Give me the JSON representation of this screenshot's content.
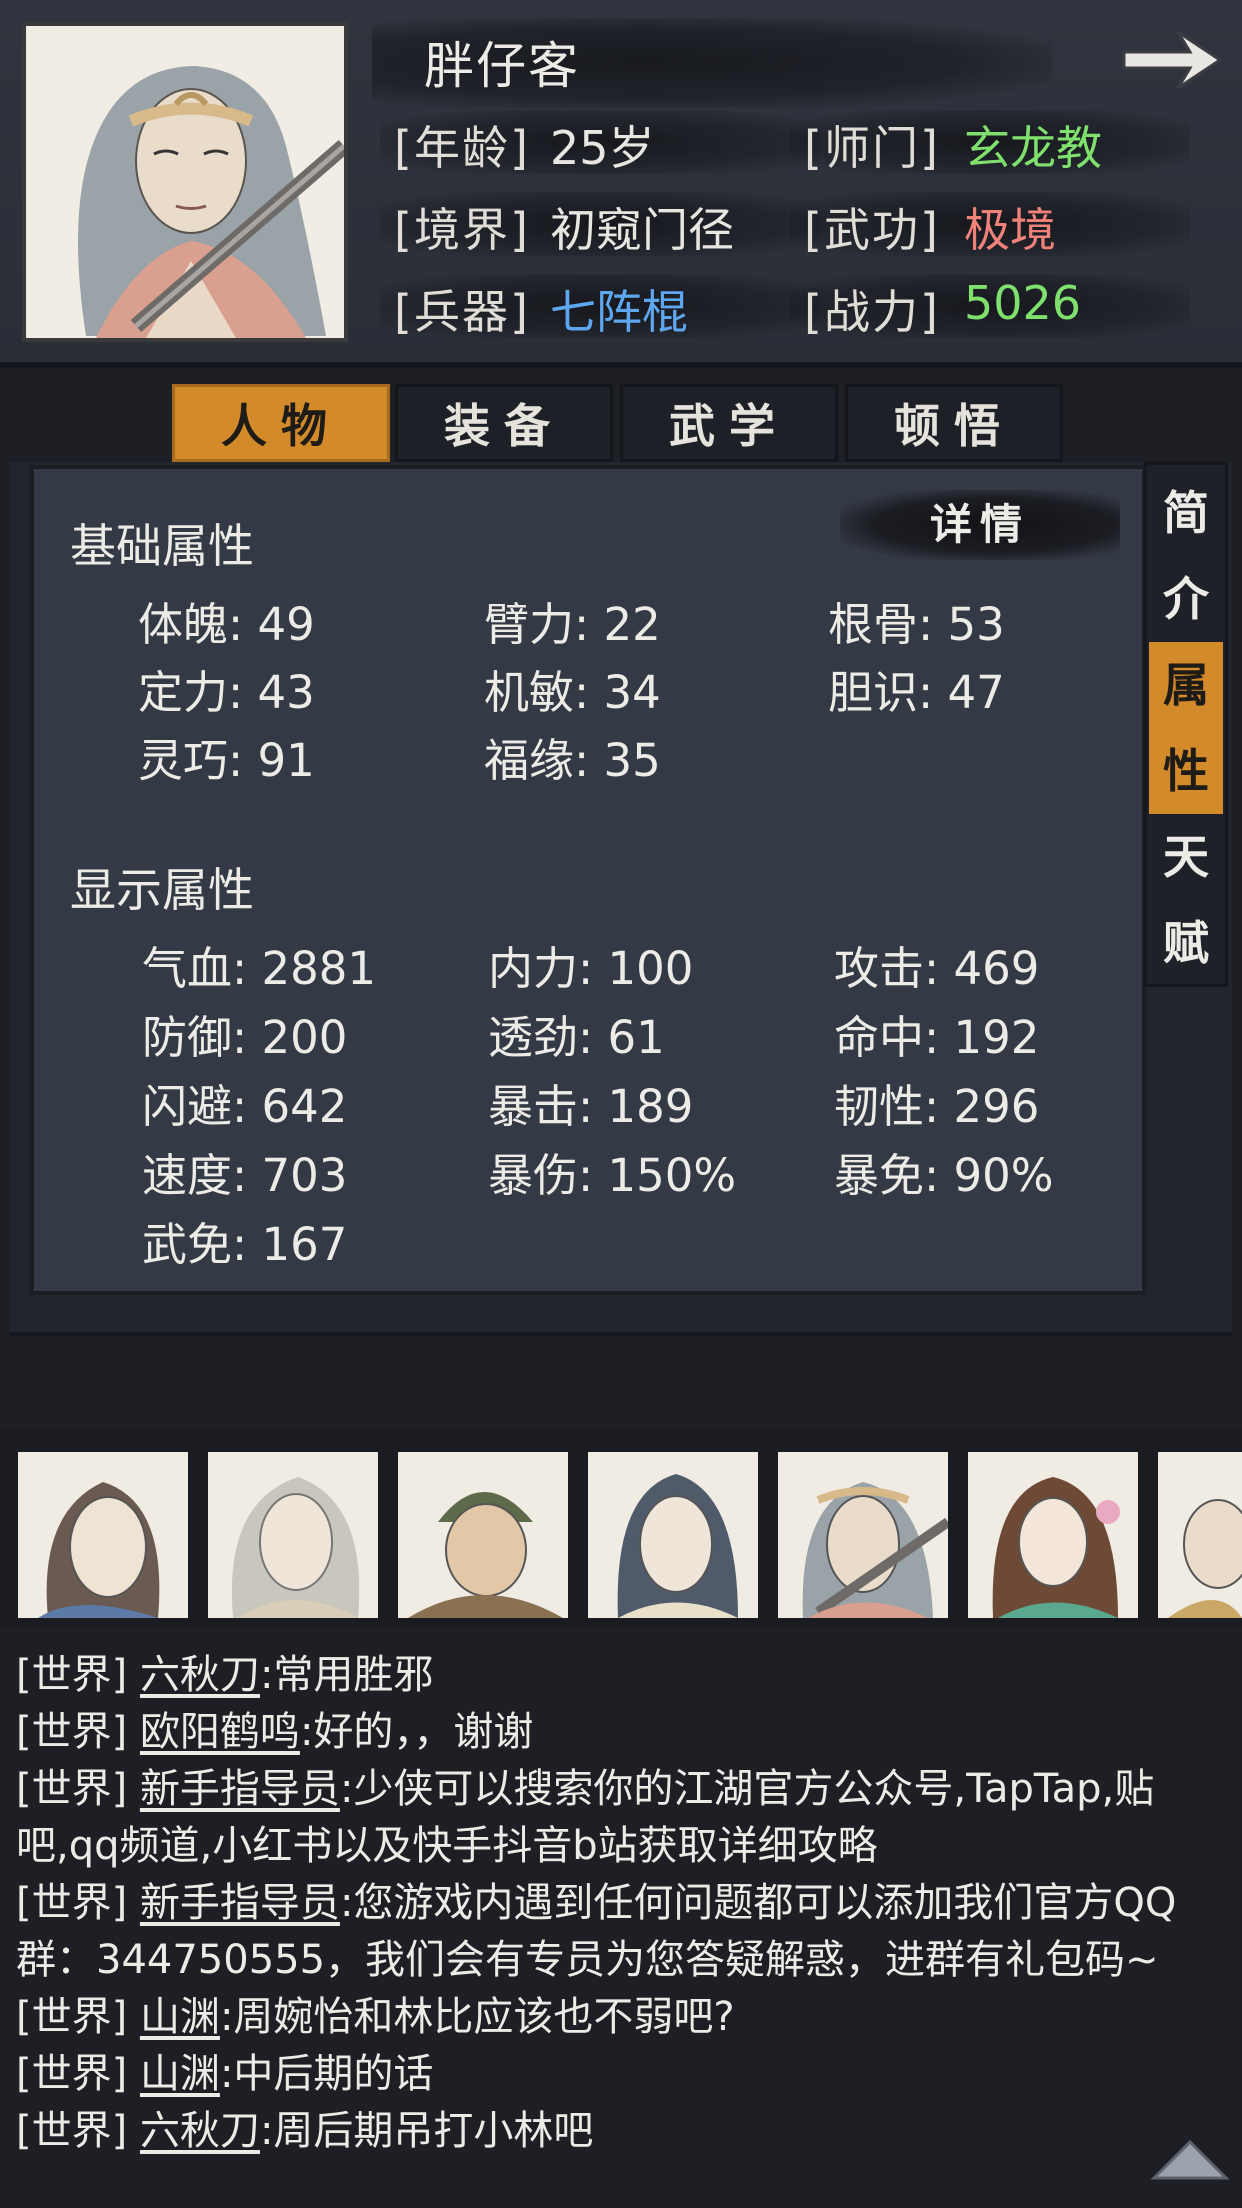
{
  "character": {
    "name": "胖仔客",
    "portrait": "character-portrait",
    "info": [
      {
        "label": "[年龄]",
        "value": "25岁",
        "color": "#e8e6e0"
      },
      {
        "label": "[师门]",
        "value": "玄龙教",
        "color": "#7fe06e"
      },
      {
        "label": "[境界]",
        "value": "初窥门径",
        "color": "#e8e6e0"
      },
      {
        "label": "[武功]",
        "value": "极境",
        "color": "#f0827a"
      },
      {
        "label": "[兵器]",
        "value": "七阵棍",
        "color": "#5ea6f0"
      },
      {
        "label": "[战力]",
        "value": "5026",
        "color": "#7fe06e"
      }
    ]
  },
  "tabs": [
    "人物",
    "装备",
    "武学",
    "顿悟"
  ],
  "side_tabs": [
    [
      "简",
      "介"
    ],
    [
      "属",
      "性"
    ],
    [
      "天",
      "赋"
    ]
  ],
  "panel": {
    "detail_label": "详情",
    "basic_title": "基础属性",
    "basic_stats": [
      "体魄: 49",
      "臂力: 22",
      "根骨: 53",
      "定力: 43",
      "机敏: 34",
      "胆识: 47",
      "灵巧: 91",
      "福缘: 35"
    ],
    "display_title": "显示属性",
    "display_stats": [
      "气血: 2881",
      "内力: 100",
      "攻击: 469",
      "防御: 200",
      "透劲: 61",
      "命中: 192",
      "闪避: 642",
      "暴击: 189",
      "韧性: 296",
      "速度: 703",
      "暴伤: 150%",
      "暴免: 90%",
      "武免: 167"
    ]
  },
  "chat": [
    {
      "channel": "[世界]",
      "user": "六秋刀",
      "msg": ":常用胜邪"
    },
    {
      "channel": "[世界]",
      "user": "欧阳鹤鸣",
      "msg": ":好的，，谢谢"
    },
    {
      "channel": "[世界]",
      "user": "新手指导员",
      "msg": ":少侠可以搜索你的江湖官方公众号,TapTap,贴"
    },
    {
      "channel": "",
      "user": "",
      "msg": "吧,qq频道,小红书以及快手抖音b站获取详细攻略"
    },
    {
      "channel": "[世界]",
      "user": "新手指导员",
      "msg": ":您游戏内遇到任何问题都可以添加我们官方QQ"
    },
    {
      "channel": "",
      "user": "",
      "msg": "群：344750555，我们会有专员为您答疑解惑，进群有礼包码~"
    },
    {
      "channel": "[世界]",
      "user": "山渊",
      "msg": ":周婉怡和林比应该也不弱吧?"
    },
    {
      "channel": "[世界]",
      "user": "山渊",
      "msg": ":中后期的话"
    },
    {
      "channel": "[世界]",
      "user": "六秋刀",
      "msg": ":周后期吊打小林吧"
    }
  ],
  "icons": {
    "next": "arrow-right-icon",
    "scroll_up": "triangle-up-icon"
  }
}
